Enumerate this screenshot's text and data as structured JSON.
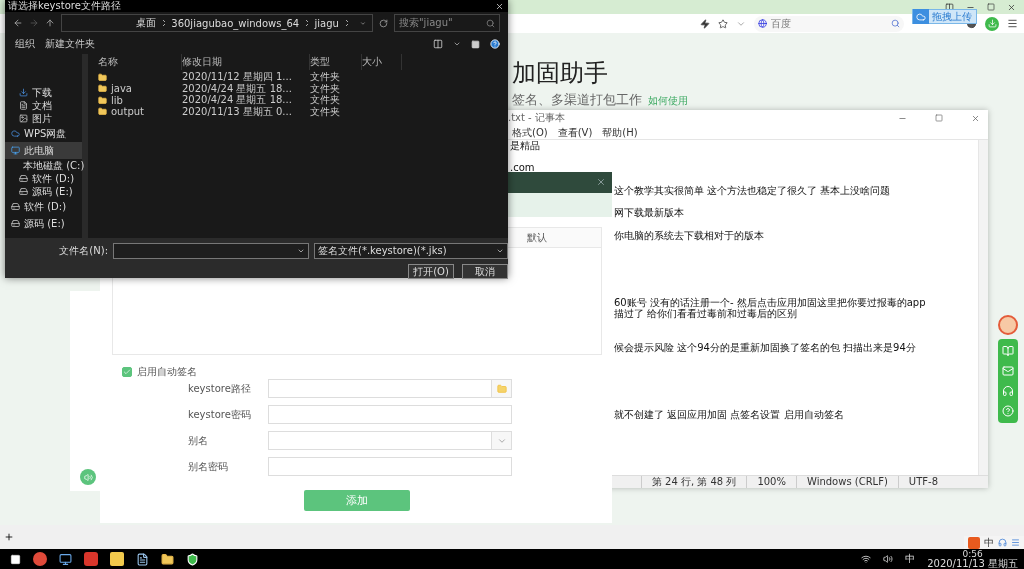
{
  "browser": {
    "search_engine": "百度",
    "upload_tip": "拖拽上传",
    "page": {
      "title": "加固助手",
      "subtitle": "签名、多渠道打包工作",
      "help_link": "如何使用"
    }
  },
  "notepad": {
    "title": ".txt - 记事本",
    "menu": [
      "格式(O)",
      "查看(V)",
      "帮助(H)"
    ],
    "lines": [
      "是精品",
      ".com",
      "这个教学其实很简单 这个方法也稳定了很久了 基本上没啥问题",
      "网下载最新版本",
      "你电脑的系统去下载相对于的版本",
      "60账号 没有的话注册一个- 然后点击应用加固这里把你要过报毒的app",
      "描过了 给你们看看过毒前和过毒后的区别",
      "候会提示风险  这个94分的是重新加固换了签名的包 扫描出来是94分",
      "就不创建了 返回应用加固 点签名设置  启用自动签名"
    ],
    "status": [
      "第 24 行, 第 48 列",
      "100%",
      "Windows (CRLF)",
      "UTF-8"
    ]
  },
  "sign_dialog": {
    "table_header": "默认",
    "auto_sign": {
      "label": "启用自动签名",
      "checked": true
    },
    "fields": [
      {
        "label": "keystore路径",
        "kind": "file"
      },
      {
        "label": "keystore密码",
        "kind": "text"
      },
      {
        "label": "别名",
        "kind": "select"
      },
      {
        "label": "别名密码",
        "kind": "text"
      }
    ],
    "submit": "添加"
  },
  "file_dialog": {
    "title": "请选择keystore文件路径",
    "breadcrumb": [
      "桌面",
      "360jiagubao_windows_64",
      "jiagu"
    ],
    "search_placeholder": "搜索\"jiagu\"",
    "toolbar": [
      "组织",
      "新建文件夹"
    ],
    "sidebar": [
      {
        "label": "下载",
        "kind": "download",
        "selected": false
      },
      {
        "label": "文档",
        "kind": "doc",
        "selected": false
      },
      {
        "label": "图片",
        "kind": "image",
        "selected": false
      },
      {
        "label": "WPS网盘",
        "kind": "cloud",
        "selected": false
      },
      {
        "label": "此电脑",
        "kind": "pc",
        "selected": true
      },
      {
        "label": "本地磁盘 (C:)",
        "kind": "drive",
        "selected": false
      },
      {
        "label": "软件 (D:)",
        "kind": "drive",
        "selected": false
      },
      {
        "label": "源码 (E:)",
        "kind": "drive",
        "selected": false
      },
      {
        "label": "软件 (D:)",
        "kind": "drive",
        "selected": false
      },
      {
        "label": "源码 (E:)",
        "kind": "drive",
        "selected": false
      }
    ],
    "columns": [
      "名称",
      "修改日期",
      "类型",
      "大小"
    ],
    "rows": [
      {
        "date": "2020/11/12 星期四 1...",
        "type": "文件夹"
      },
      {
        "name": "java",
        "date": "2020/4/24 星期五 18...",
        "type": "文件夹"
      },
      {
        "name": "lib",
        "date": "2020/4/24 星期五 18...",
        "type": "文件夹"
      },
      {
        "name": "output",
        "date": "2020/11/13 星期五 0...",
        "type": "文件夹"
      }
    ],
    "filename_label": "文件名(N):",
    "filetype": "签名文件(*.keystore)(*.jks)",
    "buttons": [
      "打开(O)",
      "取消"
    ]
  },
  "ime_bar": {
    "mode": "中"
  },
  "taskbar": {
    "ime": "中",
    "time": "0:56",
    "date": "2020/11/13 星期五"
  }
}
